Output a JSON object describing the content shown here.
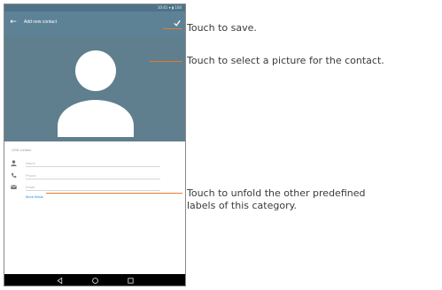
{
  "device": {
    "status_bar": {
      "text": "10:41 ▾ ▮ 100"
    },
    "app_bar": {
      "title": "Add new contact",
      "back_icon": "arrow-left-icon",
      "save_icon": "checkmark-icon"
    },
    "header": {
      "avatar_icon": "person-silhouette-icon"
    },
    "form": {
      "account_label": "USB contact",
      "fields": [
        {
          "icon": "person-icon",
          "placeholder": "Name"
        },
        {
          "icon": "phone-icon",
          "placeholder": "Phone"
        },
        {
          "icon": "email-icon",
          "placeholder": "Email"
        }
      ],
      "more_fields_link": "More fields"
    },
    "nav_bar": {
      "back_icon": "nav-back-icon",
      "home_icon": "nav-home-icon",
      "recents_icon": "nav-recents-icon"
    }
  },
  "callouts": {
    "save": "Touch to save.",
    "picture": "Touch to select a picture for the contact.",
    "labels_line1": "Touch to unfold the other predefined",
    "labels_line2": "labels of this category."
  },
  "colors": {
    "status_bar": "#4e7389",
    "app_bar": "#5d8296",
    "header_photo": "#5f7e8e",
    "accent_link": "#1e88e5",
    "callout_line": "#e87a2c"
  }
}
